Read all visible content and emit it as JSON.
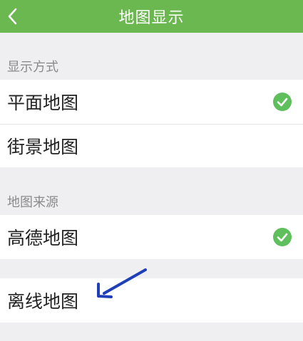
{
  "header": {
    "title": "地图显示",
    "back_icon": "chevron-left-icon"
  },
  "display_mode": {
    "label": "显示方式",
    "items": [
      {
        "label": "平面地图",
        "selected": true
      },
      {
        "label": "街景地图",
        "selected": false
      }
    ]
  },
  "map_source": {
    "label": "地图来源",
    "items": [
      {
        "label": "高德地图",
        "selected": true
      },
      {
        "label": "离线地图",
        "selected": false
      }
    ]
  },
  "colors": {
    "accent": "#6cb850",
    "check": "#5fbf5c",
    "annotation_arrow": "#1f3fb8"
  }
}
